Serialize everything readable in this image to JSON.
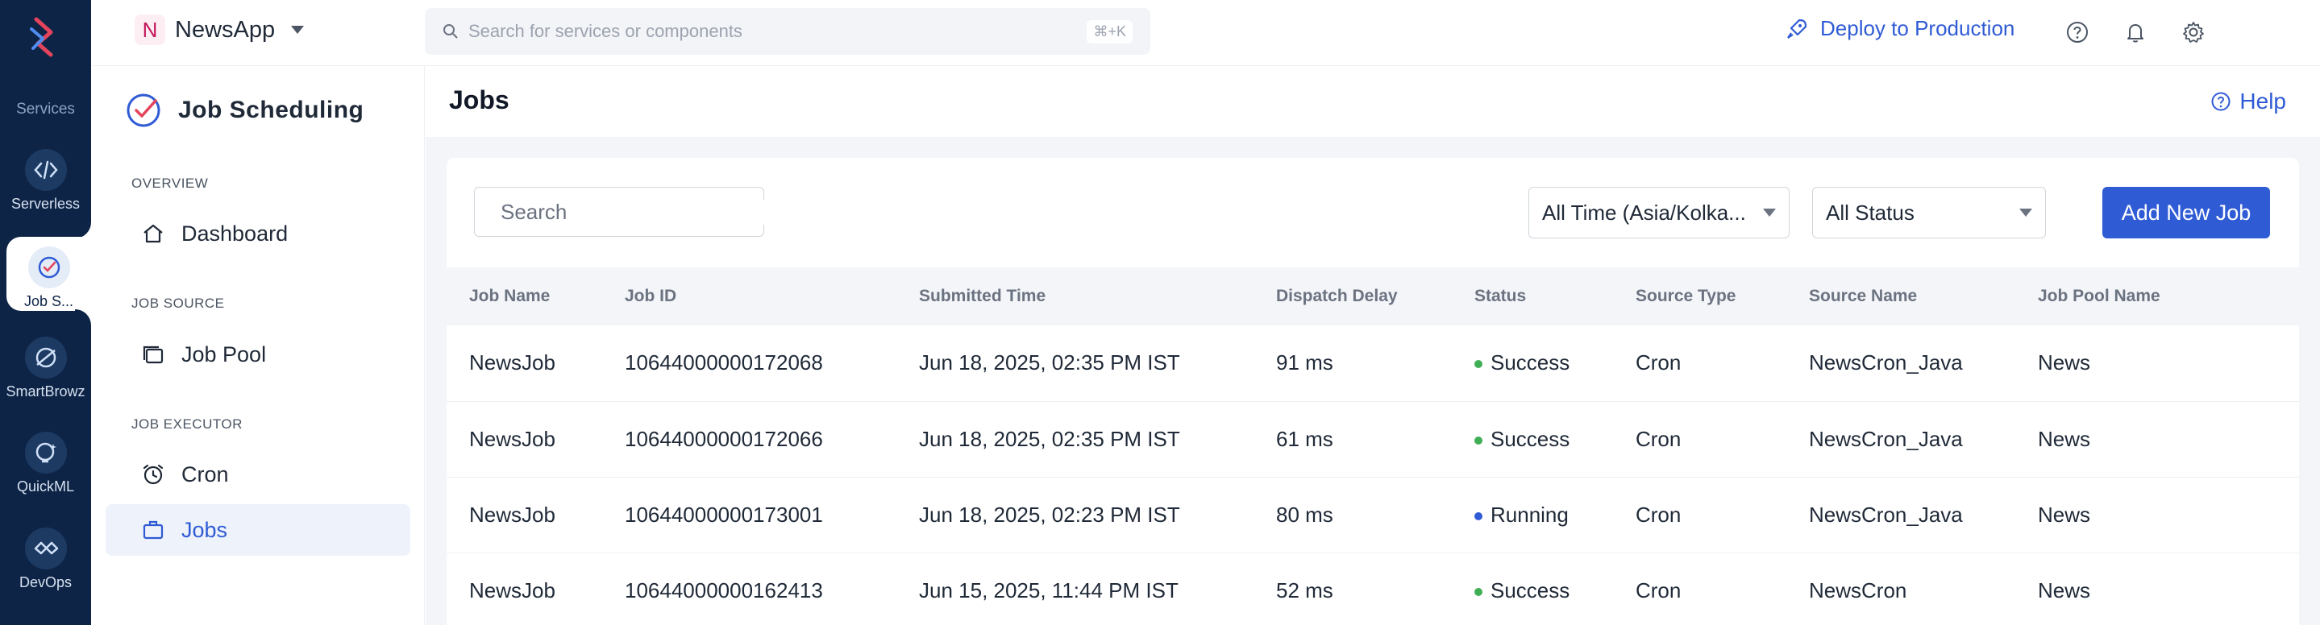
{
  "rail": {
    "section_label": "Services",
    "items": [
      {
        "label": "Serverless",
        "icon": "serverless-icon"
      },
      {
        "label": "Job S...",
        "icon": "job-scheduling-icon",
        "active": true
      },
      {
        "label": "SmartBrowz",
        "icon": "smartbrowz-icon"
      },
      {
        "label": "QuickML",
        "icon": "quickml-icon"
      },
      {
        "label": "DevOps",
        "icon": "devops-icon"
      }
    ]
  },
  "topbar": {
    "app_badge": "N",
    "app_name": "NewsApp",
    "search_placeholder": "Search for services or components",
    "search_shortcut": "⌘+K",
    "deploy_label": "Deploy to Production"
  },
  "sidepanel": {
    "title": "Job Scheduling",
    "groups": [
      {
        "label": "OVERVIEW",
        "items": [
          {
            "label": "Dashboard",
            "icon": "home-icon"
          }
        ]
      },
      {
        "label": "JOB SOURCE",
        "items": [
          {
            "label": "Job Pool",
            "icon": "stack-icon"
          }
        ]
      },
      {
        "label": "JOB EXECUTOR",
        "items": [
          {
            "label": "Cron",
            "icon": "alarm-clock-icon"
          },
          {
            "label": "Jobs",
            "icon": "briefcase-icon",
            "active": true
          }
        ]
      }
    ]
  },
  "main": {
    "title": "Jobs",
    "help_label": "Help",
    "search_placeholder": "Search",
    "time_filter": "All Time (Asia/Kolka...",
    "status_filter": "All Status",
    "add_button": "Add New Job"
  },
  "table": {
    "columns": [
      "Job Name",
      "Job ID",
      "Submitted Time",
      "Dispatch Delay",
      "Status",
      "Source Type",
      "Source Name",
      "Job Pool Name"
    ],
    "rows": [
      [
        "NewsJob",
        "10644000000172068",
        "Jun 18, 2025, 02:35 PM IST",
        "91 ms",
        "Success",
        "Cron",
        "NewsCron_Java",
        "News"
      ],
      [
        "NewsJob",
        "10644000000172066",
        "Jun 18, 2025, 02:35 PM IST",
        "61 ms",
        "Success",
        "Cron",
        "NewsCron_Java",
        "News"
      ],
      [
        "NewsJob",
        "10644000000173001",
        "Jun 18, 2025, 02:23 PM IST",
        "80 ms",
        "Running",
        "Cron",
        "NewsCron_Java",
        "News"
      ],
      [
        "NewsJob",
        "10644000000162413",
        "Jun 15, 2025, 11:44 PM IST",
        "52 ms",
        "Success",
        "Cron",
        "NewsCron",
        "News"
      ]
    ]
  },
  "colors": {
    "rail_bg": "#0d2447",
    "accent": "#2f5bd5",
    "success": "#3fae54",
    "running": "#2f5bd5"
  }
}
